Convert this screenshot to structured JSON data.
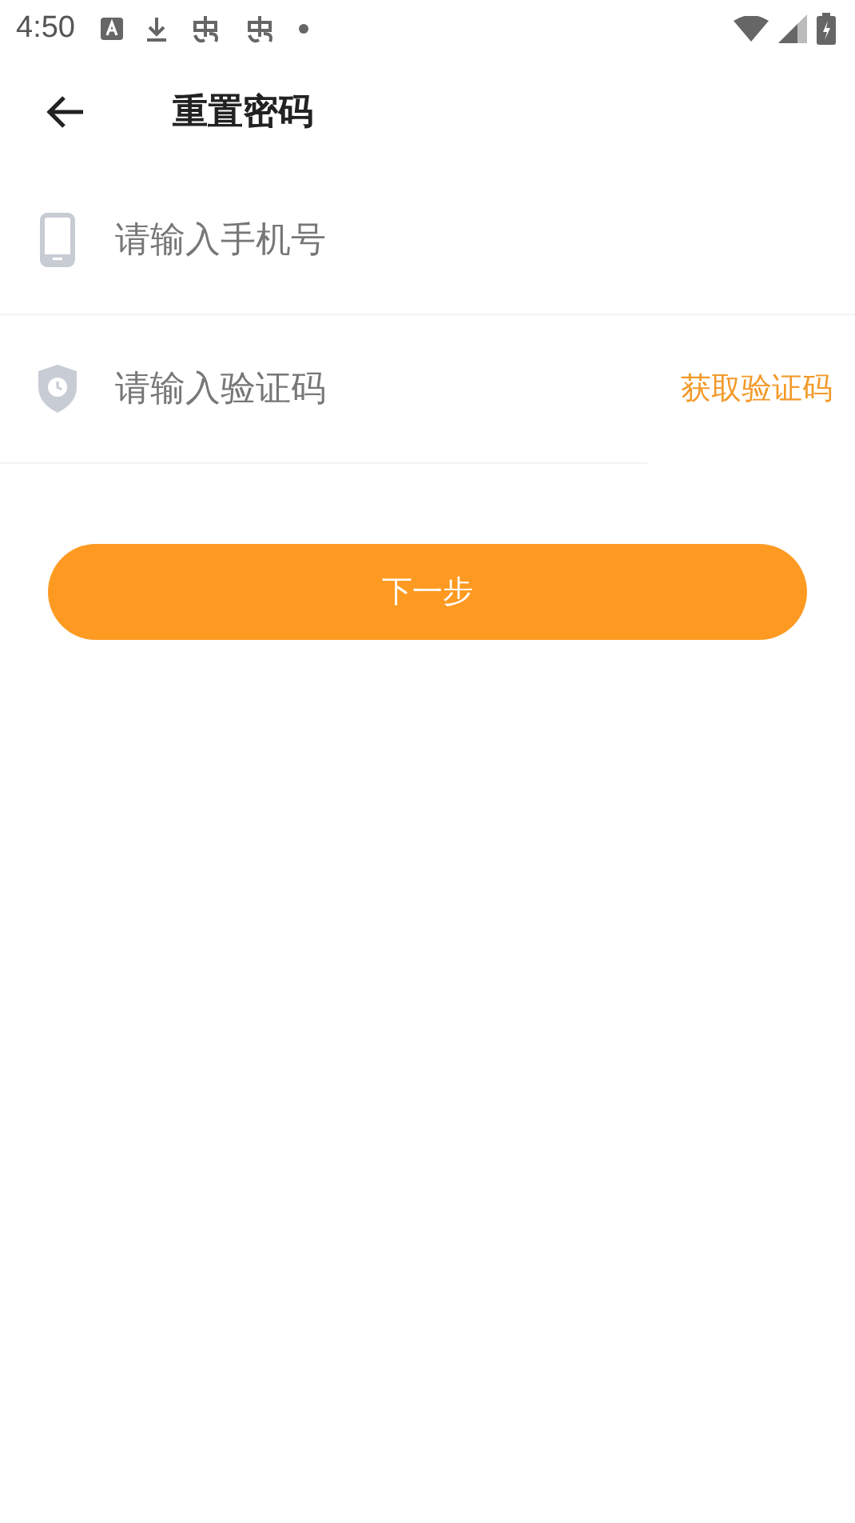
{
  "status_bar": {
    "time": "4:50"
  },
  "header": {
    "title": "重置密码"
  },
  "fields": [
    {
      "kind": "phone",
      "placeholder": "请输入手机号"
    },
    {
      "kind": "code",
      "placeholder": "请输入验证码",
      "action": "获取验证码"
    }
  ],
  "button": {
    "label": "下一步"
  }
}
